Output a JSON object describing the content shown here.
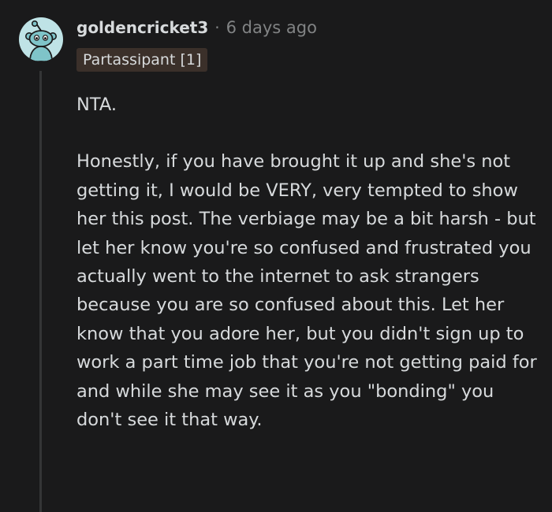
{
  "comment": {
    "username": "goldencricket3",
    "separator": "·",
    "timestamp": "6 days ago",
    "flair": "Partassipant [1]",
    "paragraphs": [
      "NTA.",
      "Honestly, if you have brought it up and she's not getting it, I would be VERY, very tempted to show her this post. The verbiage may be a bit harsh - but let her know you're so confused and frustrated you actually went to the internet to ask strangers because you are so confused about this. Let her know that you adore her, but you didn't sign up to work a part time job that you're not getting paid for and while she may see it as you \"bonding\" you don't see it that way."
    ]
  },
  "colors": {
    "background": "#1a1a1b",
    "text": "#d7dadc",
    "muted": "#818384",
    "flair_bg": "#3b302a",
    "avatar_bg": "#bfe3e6",
    "thread_line": "#343536"
  },
  "icons": {
    "avatar": "snoo-avatar-icon"
  }
}
